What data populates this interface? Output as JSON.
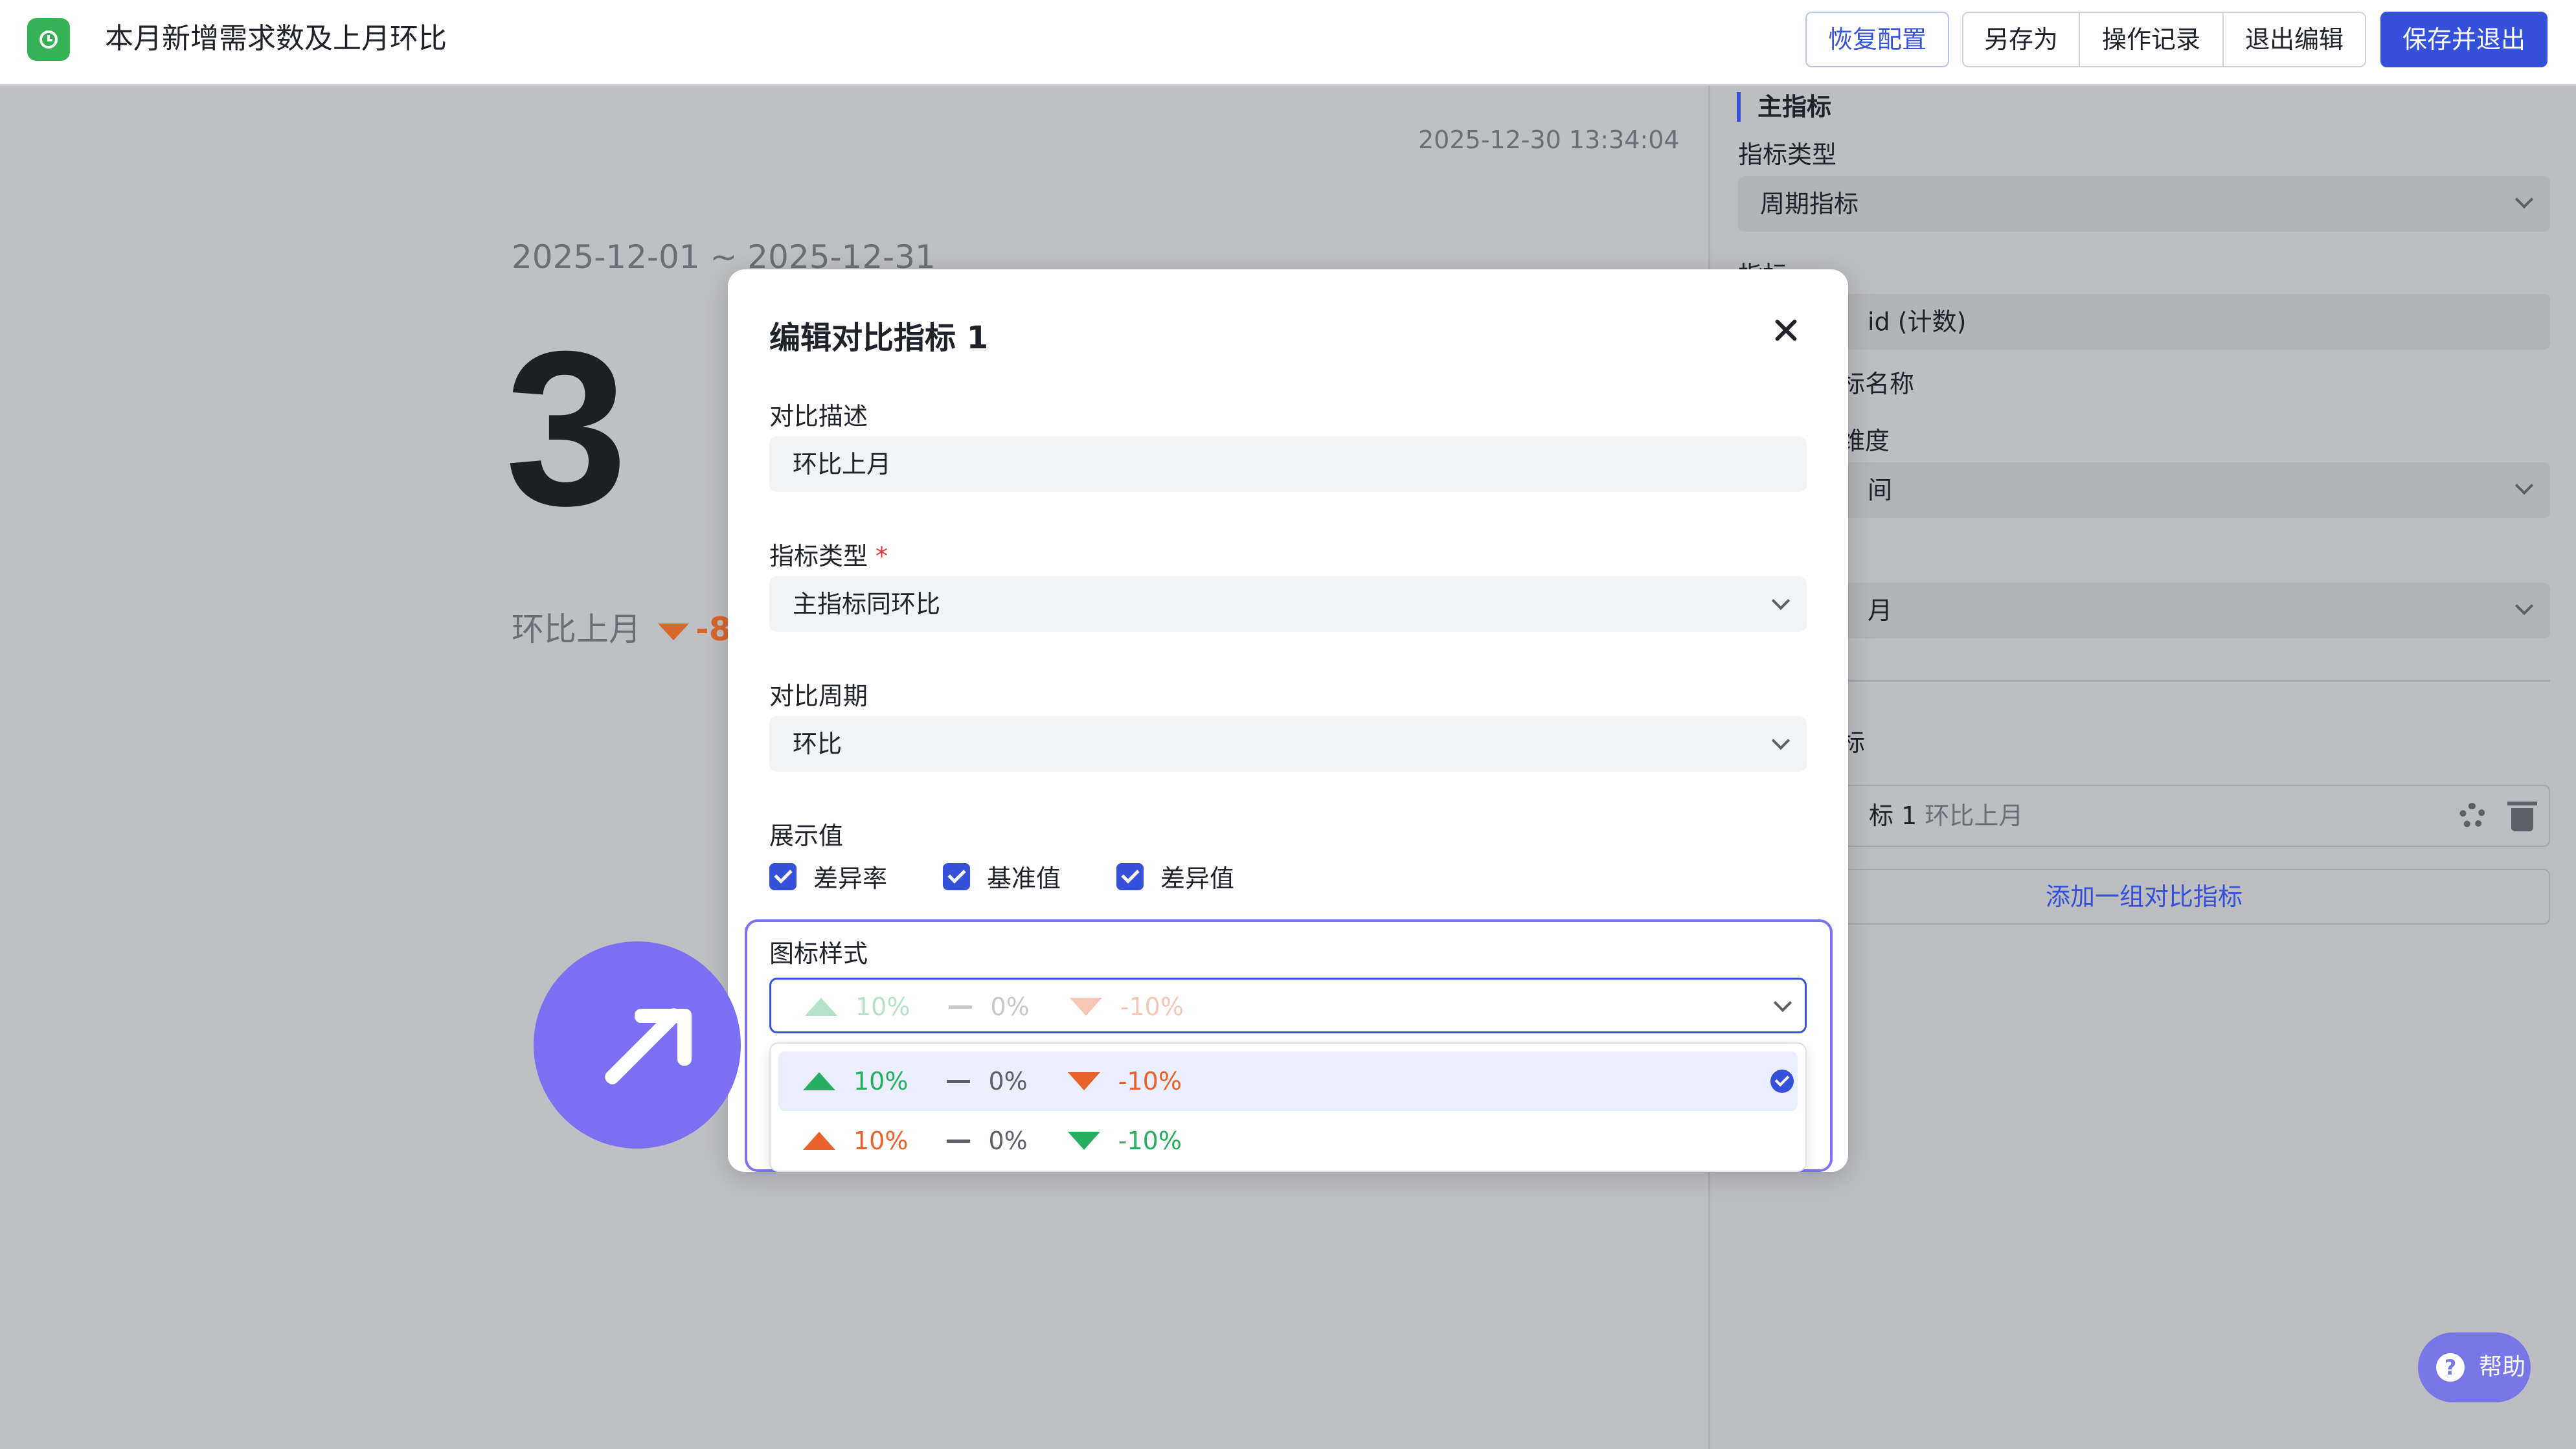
{
  "header": {
    "title": "本月新增需求数及上月环比",
    "buttons": {
      "restore": "恢复配置",
      "save_as": "另存为",
      "history": "操作记录",
      "exit_edit": "退出编辑",
      "save_exit": "保存并退出"
    }
  },
  "canvas": {
    "timestamp": "2025-12-30 13:34:04",
    "date_range": "2025-12-01 ~ 2025-12-31",
    "value": "3",
    "compare_label": "环比上月",
    "compare_value": "-8"
  },
  "panel": {
    "section_title": "主指标",
    "metric_type_label": "指标类型",
    "metric_type_value": "周期指标",
    "metric_label": "指标",
    "metric_tag": "id (计数)",
    "metric_name_hint": "标名称",
    "dimension_label": "维度",
    "dimension_value": "间",
    "period_value": "月",
    "compare_section_label": "标",
    "compare_card_name": "标 1",
    "compare_card_desc": "环比上月",
    "add_compare": "添加一组对比指标"
  },
  "modal": {
    "title": "编辑对比指标 1",
    "desc_label": "对比描述",
    "desc_value": "环比上月",
    "metric_type_label": "指标类型",
    "metric_type_required": "*",
    "metric_type_value": "主指标同环比",
    "period_label": "对比周期",
    "period_value": "环比",
    "display_label": "展示值",
    "checkboxes": [
      {
        "label": "差异率",
        "checked": true
      },
      {
        "label": "基准值",
        "checked": true
      },
      {
        "label": "差异值",
        "checked": true
      }
    ],
    "icon_style_label": "图标样式",
    "selected_style": {
      "up": "10%",
      "flat": "0%",
      "down": "-10%"
    },
    "options": [
      {
        "up": "10%",
        "flat": "0%",
        "down": "-10%",
        "up_color": "#27ae60",
        "down_color": "#e8622c",
        "selected": true
      },
      {
        "up": "10%",
        "flat": "0%",
        "down": "-10%",
        "up_color": "#e8622c",
        "down_color": "#27ae60",
        "selected": false
      }
    ]
  },
  "help": {
    "label": "帮助"
  },
  "colors": {
    "primary": "#3550d9",
    "accent": "#7b6ff2",
    "up_green": "#27ae60",
    "down_orange": "#e8622c"
  }
}
